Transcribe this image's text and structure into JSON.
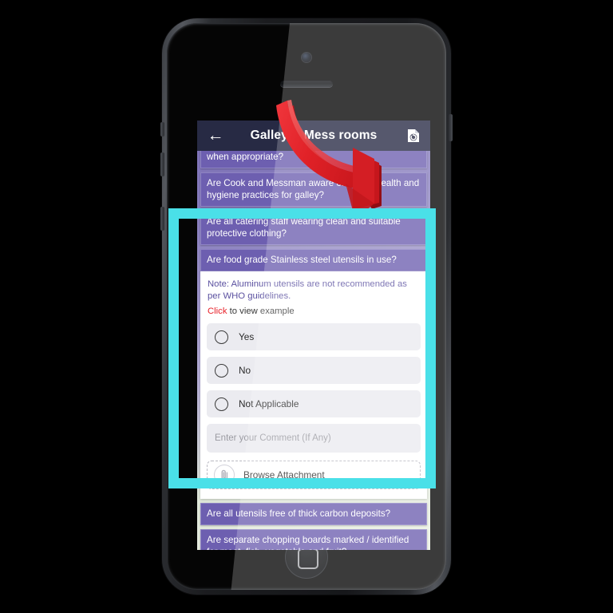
{
  "app": {
    "title": "Galley & Mess rooms",
    "back_icon": "back-arrow-icon",
    "reset_icon": "document-revert-icon"
  },
  "questions_above": [
    {
      "text": "when appropriate?",
      "partial": true
    },
    {
      "text": "Are Cook and Messman aware of proper health and hygiene practices for galley?",
      "partial": false
    },
    {
      "text": "Are all catering staff wearing clean and suitable protective clothing?",
      "partial": false
    }
  ],
  "expanded_question": {
    "header": "Are food grade Stainless steel utensils in use?",
    "note": "Note: Aluminum utensils are not recommended as per WHO guidelines.",
    "click_link": "Click",
    "click_rest": " to view example",
    "options": [
      {
        "label": "Yes",
        "selected": false
      },
      {
        "label": "No",
        "selected": false
      },
      {
        "label": "Not Applicable",
        "selected": false
      }
    ],
    "comment_placeholder": "Enter your Comment (If Any)",
    "attachment_label": "Browse Attachment",
    "attachment_icon": "paperclip-icon"
  },
  "questions_below": [
    {
      "text": "Are all utensils free of thick carbon deposits?",
      "partial": true
    },
    {
      "text": "Are separate chopping boards marked / identified for meat, fish, vegetable and fruit?",
      "partial": false
    }
  ],
  "annotations": {
    "highlight_color": "#4ae0e8",
    "arrow_color": "#e8262b",
    "arrow_name": "red-pointer-arrow"
  },
  "colors": {
    "appbar_bg": "#272a44",
    "question_bar_bg": "#6d5fb0",
    "link_red": "#e8222a",
    "note_purple": "#5b51a0",
    "option_bg": "#ebebf0"
  }
}
